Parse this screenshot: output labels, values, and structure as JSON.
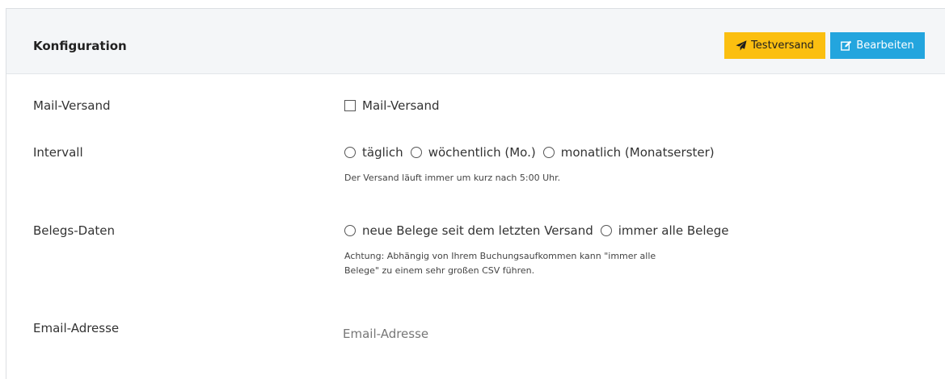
{
  "panel": {
    "title": "Konfiguration",
    "buttons": {
      "test_label": "Testversand",
      "test_icon": "paper-plane-icon",
      "edit_label": "Bearbeiten",
      "edit_icon": "edit-icon"
    }
  },
  "colors": {
    "test_button_bg": "#fbbf10",
    "edit_button_bg": "#23a5de",
    "header_bg": "#f4f6f8"
  },
  "form": {
    "mail_versand": {
      "label": "Mail-Versand",
      "checkbox_label": "Mail-Versand",
      "checked": false
    },
    "intervall": {
      "label": "Intervall",
      "options": [
        "täglich",
        "wöchentlich (Mo.)",
        "monatlich (Monatserster)"
      ],
      "help": "Der Versand läuft immer um kurz nach 5:00 Uhr."
    },
    "belegs_daten": {
      "label": "Belegs-Daten",
      "options": [
        "neue Belege seit dem letzten Versand",
        "immer alle Belege"
      ],
      "help_line1": "Achtung: Abhängig von Ihrem Buchungsaufkommen kann \"immer alle",
      "help_line2": "Belege\" zu einem sehr großen CSV führen."
    },
    "email": {
      "label": "Email-Adresse",
      "placeholder": "Email-Adresse",
      "value": ""
    }
  }
}
